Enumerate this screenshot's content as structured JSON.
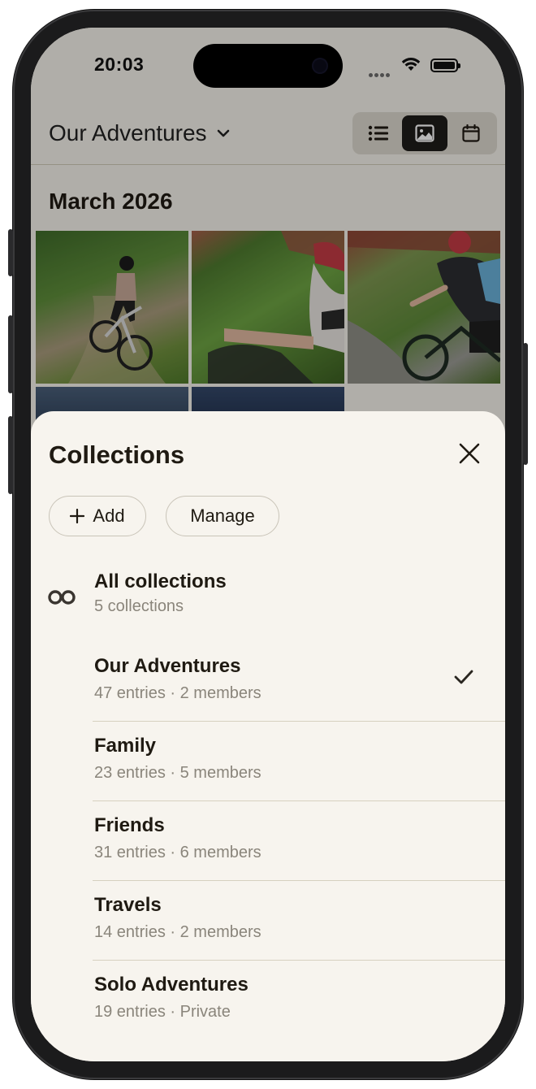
{
  "status_bar": {
    "time": "20:03"
  },
  "header": {
    "title": "Our Adventures",
    "view_options": [
      "list-view",
      "gallery-view",
      "calendar-view"
    ],
    "active_view": "gallery-view"
  },
  "timeline": {
    "month_label": "March 2026"
  },
  "sheet": {
    "title": "Collections",
    "add_label": "Add",
    "manage_label": "Manage",
    "all": {
      "title": "All collections",
      "subtitle": "5 collections"
    },
    "collections": [
      {
        "name": "Our Adventures",
        "meta": "47 entries · 2 members",
        "selected": true
      },
      {
        "name": "Family",
        "meta": "23 entries · 5 members",
        "selected": false
      },
      {
        "name": "Friends",
        "meta": "31 entries · 6 members",
        "selected": false
      },
      {
        "name": "Travels",
        "meta": "14 entries · 2 members",
        "selected": false
      },
      {
        "name": "Solo Adventures",
        "meta": "19 entries · Private",
        "selected": false
      }
    ]
  },
  "colors": {
    "sheet_bg": "#f7f4ee",
    "text_primary": "#1f1a12",
    "text_secondary": "#8a857b",
    "divider": "#d6d1c0"
  }
}
